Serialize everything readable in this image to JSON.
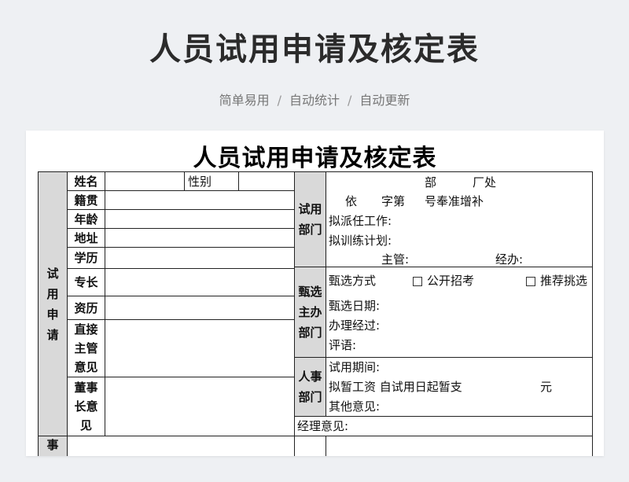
{
  "banner": {
    "title": "人员试用申请及核定表",
    "sub1": "简单易用",
    "sub2": "自动统计",
    "sub3": "自动更新",
    "separator": "/"
  },
  "doc": {
    "title": "人员试用申请及核定表",
    "section_left": [
      "试",
      "用",
      "申",
      "请"
    ],
    "section_bottom": "事",
    "fields": {
      "name": "姓名",
      "gender": "性别",
      "origin": "籍贯",
      "age": "年龄",
      "address": "地址",
      "education": "学历",
      "specialty": "专长",
      "experience": "资历",
      "supervisor_opinion": [
        "直接",
        "主管",
        "意见"
      ],
      "director_opinion": [
        "董事",
        "长意",
        "见"
      ]
    },
    "trial_dept": {
      "label": [
        "试用",
        "部门"
      ],
      "line1_dept": "部",
      "line1_office": "厂处",
      "line2": [
        "依",
        "字第",
        "号奉准增补"
      ],
      "assign": "拟派任工作:",
      "training": "拟训练计划:",
      "manager": "主管:",
      "handler": "经办:"
    },
    "selection_dept": {
      "label": [
        "甄选",
        "主办",
        "部门"
      ],
      "method": "甄选方式",
      "option1": "公开招考",
      "option2": "推荐挑选",
      "date": "甄选日期:",
      "process": "办理经过:",
      "comment": "评语:"
    },
    "hr_dept": {
      "label": [
        "人事",
        "部门"
      ],
      "period": "试用期间:",
      "salary_prefix": "拟暂工资 自试用日起暂支",
      "salary_unit": "元",
      "other": "其他意见:"
    },
    "gm_opinion": "经理意见:"
  }
}
